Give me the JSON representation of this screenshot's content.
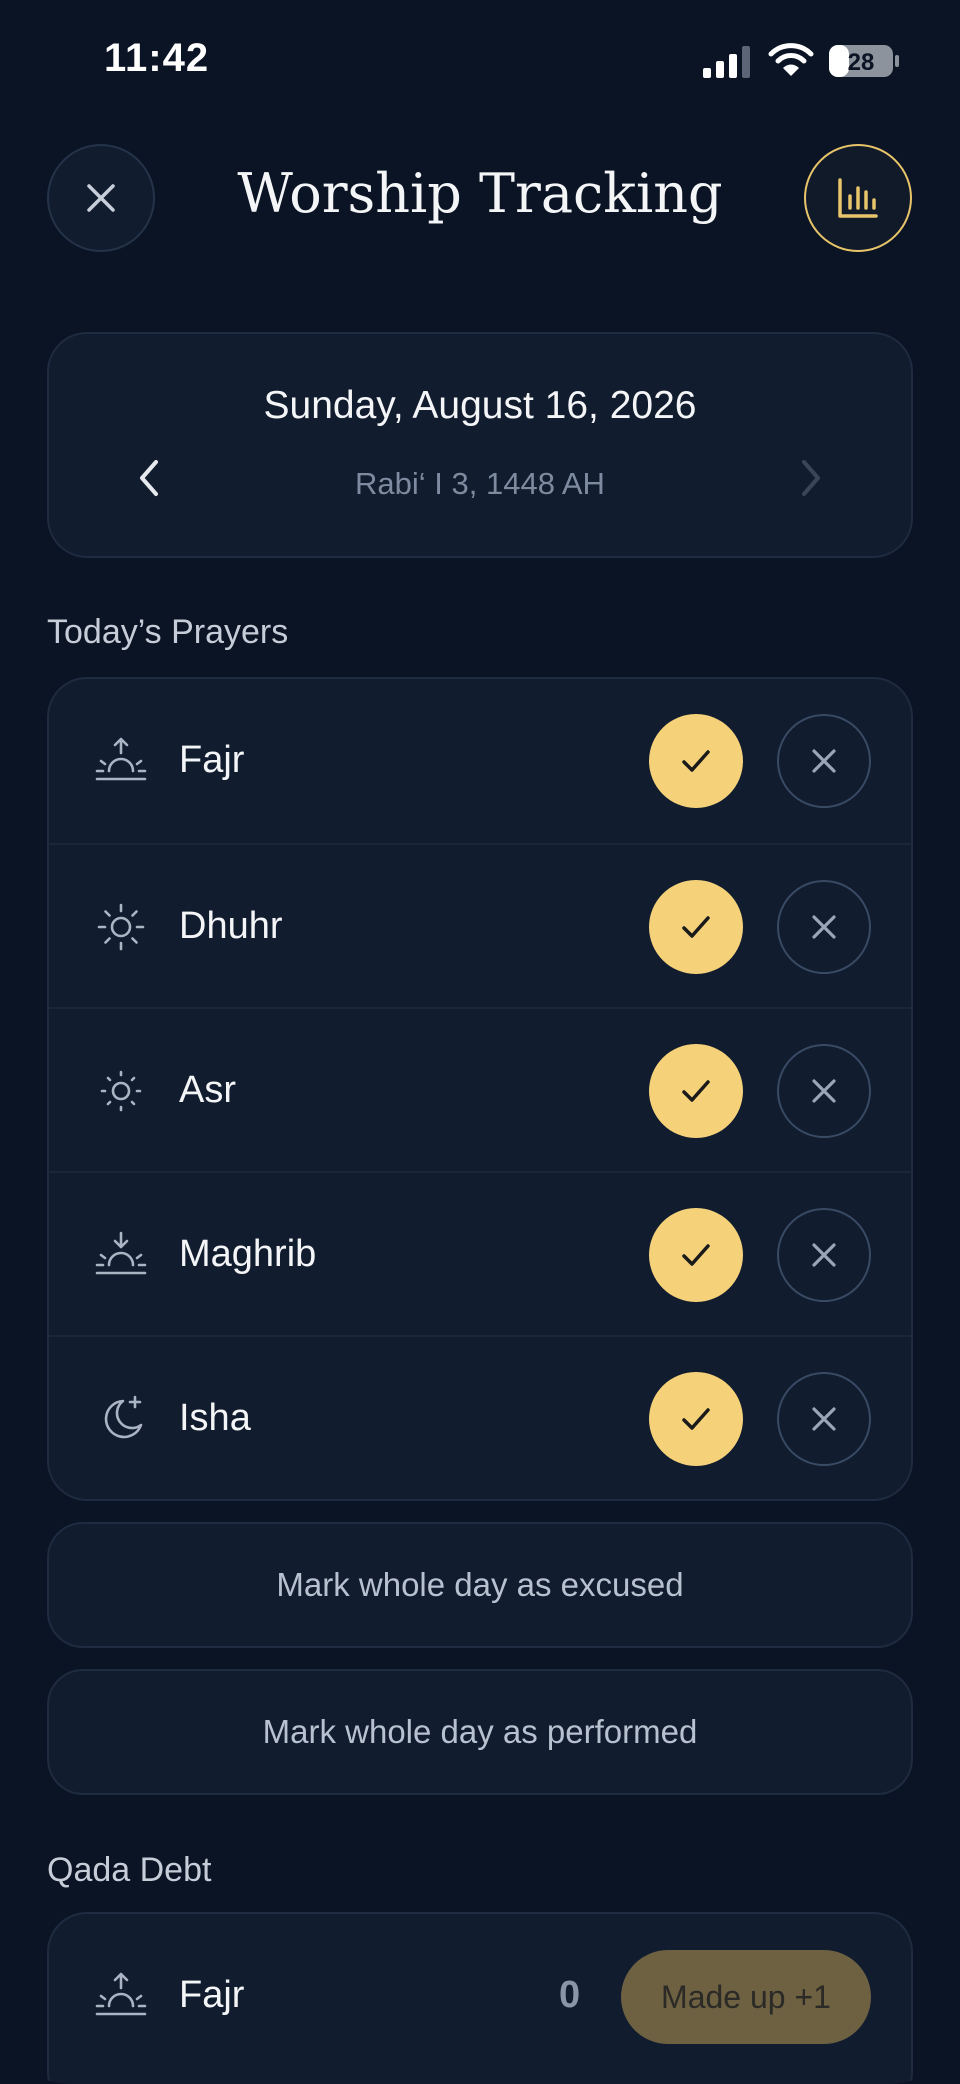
{
  "status_bar": {
    "time": "11:42",
    "battery": "28"
  },
  "header": {
    "title": "Worship Tracking"
  },
  "date": {
    "gregorian": "Sunday, August 16, 2026",
    "hijri": "Rabi‘ I 3, 1448 AH"
  },
  "prayers_section": {
    "label": "Today’s Prayers",
    "items": [
      {
        "name": "Fajr",
        "icon": "sunrise-icon"
      },
      {
        "name": "Dhuhr",
        "icon": "sun-icon"
      },
      {
        "name": "Asr",
        "icon": "sun-small-icon"
      },
      {
        "name": "Maghrib",
        "icon": "sunset-icon"
      },
      {
        "name": "Isha",
        "icon": "moon-star-icon"
      }
    ]
  },
  "actions": {
    "excused": "Mark whole day as excused",
    "performed": "Mark whole day as performed"
  },
  "qada": {
    "label": "Qada Debt",
    "items": [
      {
        "name": "Fajr",
        "count": "0",
        "button": "Made up +1"
      }
    ]
  },
  "colors": {
    "background": "#0b1424",
    "card": "#111c2e",
    "accent": "#f5d27a"
  }
}
